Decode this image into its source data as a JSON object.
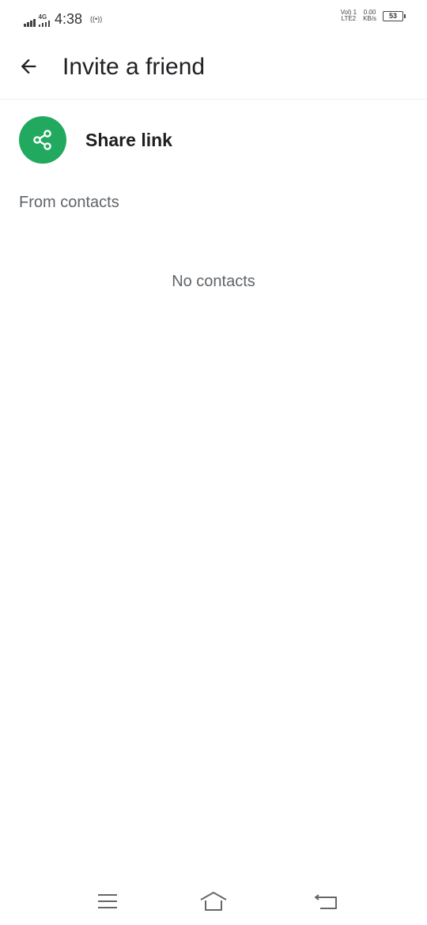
{
  "status_bar": {
    "network_type": "4G",
    "time": "4:38",
    "hotspot_icon": "((•))",
    "volte_line1": "Vol) 1",
    "volte_line2": "LTE2",
    "speed_value": "0.00",
    "speed_unit": "KB/s",
    "battery_level": "53",
    "icons": [
      "signal-icon",
      "signal-icon",
      "hotspot-icon",
      "battery-icon"
    ]
  },
  "app_bar": {
    "title": "Invite a friend",
    "back_icon": "arrow-left-icon"
  },
  "share": {
    "label": "Share link",
    "icon": "share-icon",
    "color": "#21a95f"
  },
  "contacts": {
    "section_title": "From contacts",
    "empty_message": "No contacts"
  },
  "nav_bar": {
    "icons": [
      "menu-icon",
      "home-icon",
      "back-icon"
    ]
  }
}
